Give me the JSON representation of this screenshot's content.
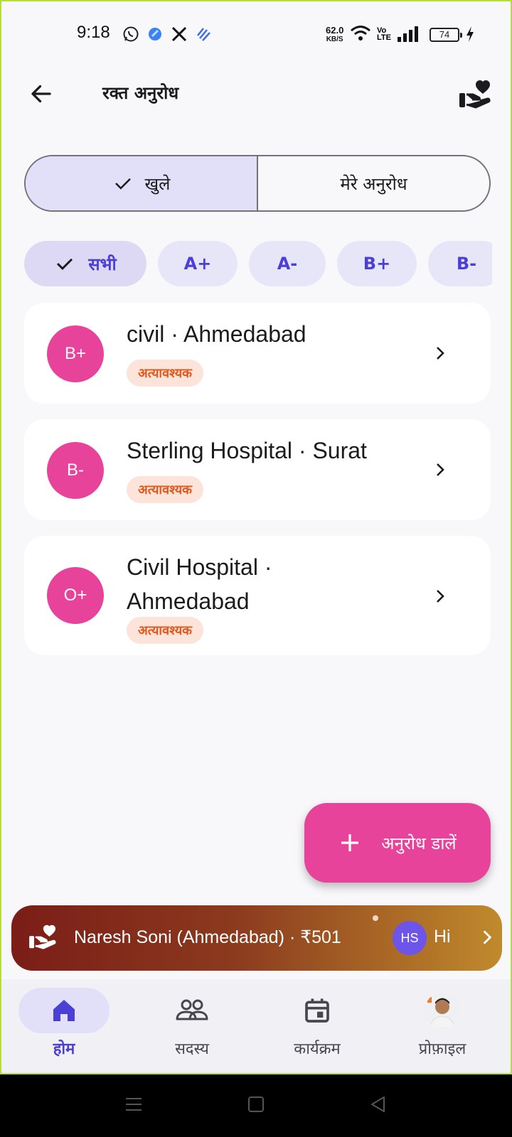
{
  "status_bar": {
    "time": "9:18",
    "net_speed_value": "62.0",
    "net_speed_unit": "KB/S",
    "battery": "74"
  },
  "header": {
    "title": "रक्त अनुरोध",
    "back_icon": "arrow-back-icon",
    "action_icon": "volunteer-activism-icon"
  },
  "segmented": {
    "open_label": "खुले",
    "mine_label": "मेरे अनुरोध",
    "selected": "open"
  },
  "filters": {
    "chips": [
      "सभी",
      "A+",
      "A-",
      "B+",
      "B-"
    ],
    "selected": "सभी"
  },
  "requests": [
    {
      "blood_group": "B+",
      "title": "civil · Ahmedabad",
      "urgency": "अत्यावश्यक"
    },
    {
      "blood_group": "B-",
      "title": "Sterling Hospital · Surat",
      "urgency": "अत्यावश्यक"
    },
    {
      "blood_group": "O+",
      "title": "Civil Hospital · Ahmedabad",
      "urgency": "अत्यावश्यक"
    }
  ],
  "fab": {
    "label": "अनुरोध डालें",
    "icon": "plus-icon"
  },
  "ticker": {
    "text": "Naresh Soni (Ahmedabad) · ₹501",
    "avatar_initials": "HS",
    "next_text": "Hi"
  },
  "bottom_nav": {
    "items": [
      {
        "label": "होम",
        "icon": "home-icon"
      },
      {
        "label": "सदस्य",
        "icon": "members-icon"
      },
      {
        "label": "कार्यक्रम",
        "icon": "calendar-icon"
      },
      {
        "label": "प्रोफ़ाइल",
        "icon": "profile-avatar"
      }
    ],
    "active": "होम"
  },
  "colors": {
    "accent": "#4b3fd6",
    "pink": "#e8439a",
    "urgent_text": "#e0581c",
    "urgent_bg": "#fde4da",
    "chip_bg": "#e7e6f9"
  }
}
